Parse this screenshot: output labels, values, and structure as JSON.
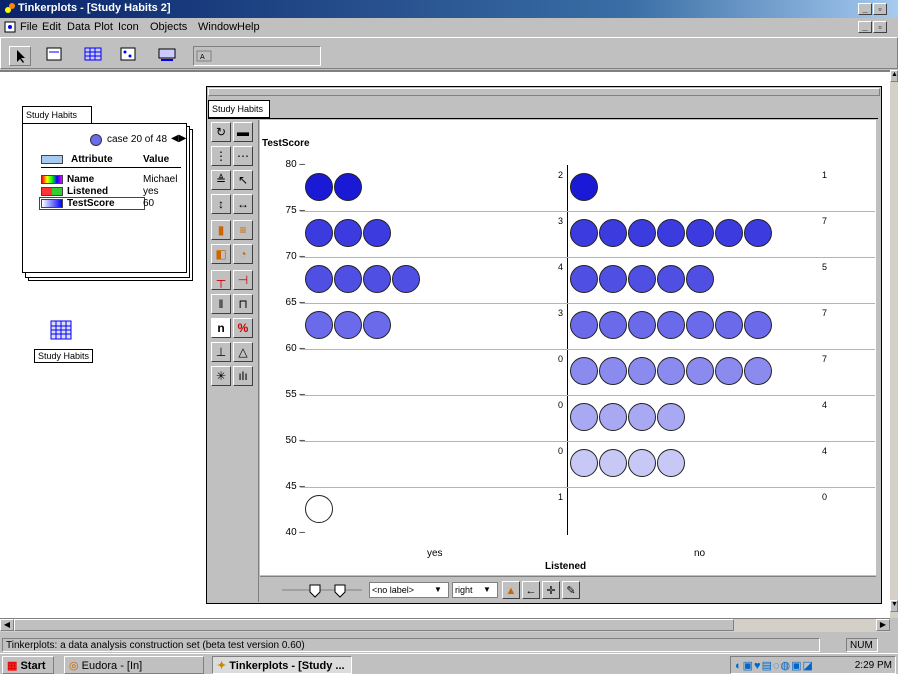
{
  "app": {
    "title": "Tinkerplots - [Study Habits 2]"
  },
  "menu": [
    "File",
    "Edit",
    "Data",
    "Plot",
    "Icon",
    "Objects",
    "Window",
    "Help"
  ],
  "card": {
    "tab_title": "Study Habits",
    "case_label": "case 20 of 48",
    "col_attribute": "Attribute",
    "col_value": "Value",
    "rows": [
      {
        "attribute": "Name",
        "value": "Michael"
      },
      {
        "attribute": "Listened",
        "value": "yes"
      },
      {
        "attribute": "TestScore",
        "value": "60"
      }
    ]
  },
  "table_icon_label": "Study Habits",
  "plot": {
    "tab_title": "Study Habits",
    "y_attribute": "TestScore",
    "x_attribute": "Listened",
    "label_select": "<no label>",
    "position_select": "right",
    "count_toggle": "n",
    "percent_toggle": "%"
  },
  "chart_data": {
    "type": "scatter",
    "xlabel": "Listened",
    "ylabel": "TestScore",
    "categories": [
      "yes",
      "no"
    ],
    "y_ticks": [
      "80",
      "75",
      "70",
      "65",
      "60",
      "55",
      "50",
      "45",
      "40"
    ],
    "bins": [
      {
        "range": [
          75,
          80
        ],
        "yes": 2,
        "no": 1
      },
      {
        "range": [
          70,
          75
        ],
        "yes": 3,
        "no": 7
      },
      {
        "range": [
          65,
          70
        ],
        "yes": 4,
        "no": 5
      },
      {
        "range": [
          60,
          65
        ],
        "yes": 3,
        "no": 7
      },
      {
        "range": [
          55,
          60
        ],
        "yes": 0,
        "no": 7
      },
      {
        "range": [
          50,
          55
        ],
        "yes": 0,
        "no": 4
      },
      {
        "range": [
          45,
          50
        ],
        "yes": 0,
        "no": 4
      },
      {
        "range": [
          40,
          45
        ],
        "yes": 1,
        "no": 0
      }
    ],
    "bin_count_labels": {
      "yes": [
        "2",
        "3",
        "4",
        "3",
        "0",
        "0",
        "0",
        "1"
      ],
      "no": [
        "1",
        "7",
        "5",
        "7",
        "7",
        "4",
        "4",
        "0"
      ]
    },
    "bin_colors": [
      "#1a1ad6",
      "#3b3bdf",
      "#4f4fe3",
      "#6a6aea",
      "#8a8aef",
      "#a8a8f3",
      "#c8c8f7",
      "#ffffff"
    ]
  },
  "status": {
    "text": "Tinkerplots: a data analysis construction set (beta test version 0.60)",
    "num": "NUM"
  },
  "taskbar": {
    "start": "Start",
    "task1": "Eudora - [In]",
    "task2": "Tinkerplots - [Study ...",
    "clock": "2:29 PM"
  }
}
